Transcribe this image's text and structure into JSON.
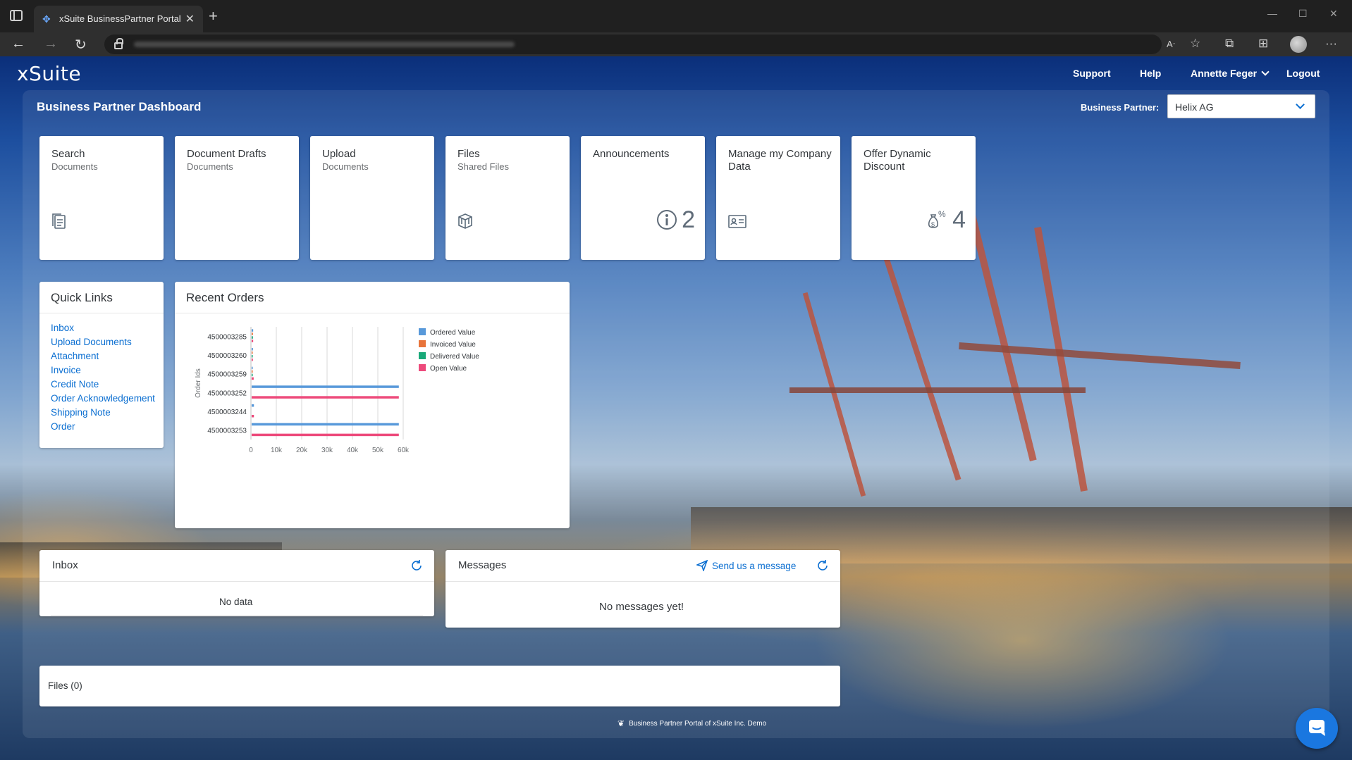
{
  "browser": {
    "tab_title": "xSuite BusinessPartner Portal"
  },
  "app": {
    "logo": "xSuite",
    "nav": {
      "support": "Support",
      "help": "Help",
      "user": "Annette Feger",
      "logout": "Logout"
    },
    "page_title": "Business Partner Dashboard",
    "business_partner_label": "Business Partner:",
    "business_partner_value": "Helix AG"
  },
  "tiles": [
    {
      "title": "Search",
      "subtitle": "Documents",
      "icon": "documents-icon"
    },
    {
      "title": "Document Drafts",
      "subtitle": "Documents"
    },
    {
      "title": "Upload",
      "subtitle": "Documents"
    },
    {
      "title": "Files",
      "subtitle": "Shared Files",
      "icon": "shared-files-icon"
    },
    {
      "title": "Announcements",
      "subtitle": "",
      "icon": "info-icon",
      "count": "2"
    },
    {
      "title": "Manage my Company Data",
      "subtitle": "",
      "icon": "company-card-icon"
    },
    {
      "title": "Offer Dynamic Discount",
      "subtitle": "",
      "icon": "discount-money-icon",
      "count": "4"
    }
  ],
  "quick_links": {
    "title": "Quick Links",
    "items": [
      "Inbox",
      "Upload Documents",
      "Attachment",
      "Invoice",
      "Credit Note",
      "Order Acknowledgement",
      "Shipping Note",
      "Order"
    ]
  },
  "recent_orders": {
    "title": "Recent Orders"
  },
  "chart_data": {
    "type": "bar",
    "orientation": "horizontal",
    "title": "Recent Orders",
    "ylabel": "Order Ids",
    "xlabel": "",
    "categories": [
      "4500003285",
      "4500003260",
      "4500003259",
      "4500003252",
      "4500003244",
      "4500003253"
    ],
    "xlim": [
      0,
      60000
    ],
    "x_ticks": [
      "0",
      "10k",
      "20k",
      "30k",
      "40k",
      "50k",
      "60k"
    ],
    "legend_position": "right",
    "grid": true,
    "series": [
      {
        "name": "Ordered Value",
        "color": "#5899da",
        "values": [
          600,
          500,
          400,
          58000,
          900,
          58000
        ]
      },
      {
        "name": "Invoiced Value",
        "color": "#e8743b",
        "values": [
          500,
          300,
          300,
          0,
          0,
          0
        ]
      },
      {
        "name": "Delivered Value",
        "color": "#19a979",
        "values": [
          500,
          300,
          300,
          0,
          0,
          0
        ]
      },
      {
        "name": "Open Value",
        "color": "#ed4a7b",
        "values": [
          600,
          500,
          800,
          58000,
          900,
          58000
        ]
      }
    ]
  },
  "inbox": {
    "title": "Inbox",
    "empty_text": "No data"
  },
  "messages": {
    "title": "Messages",
    "send_label": "Send us a message",
    "empty_text": "No messages yet!"
  },
  "files": {
    "title": "Files (0)"
  },
  "footer": {
    "text": "Business Partner Portal of xSuite Inc. Demo"
  }
}
